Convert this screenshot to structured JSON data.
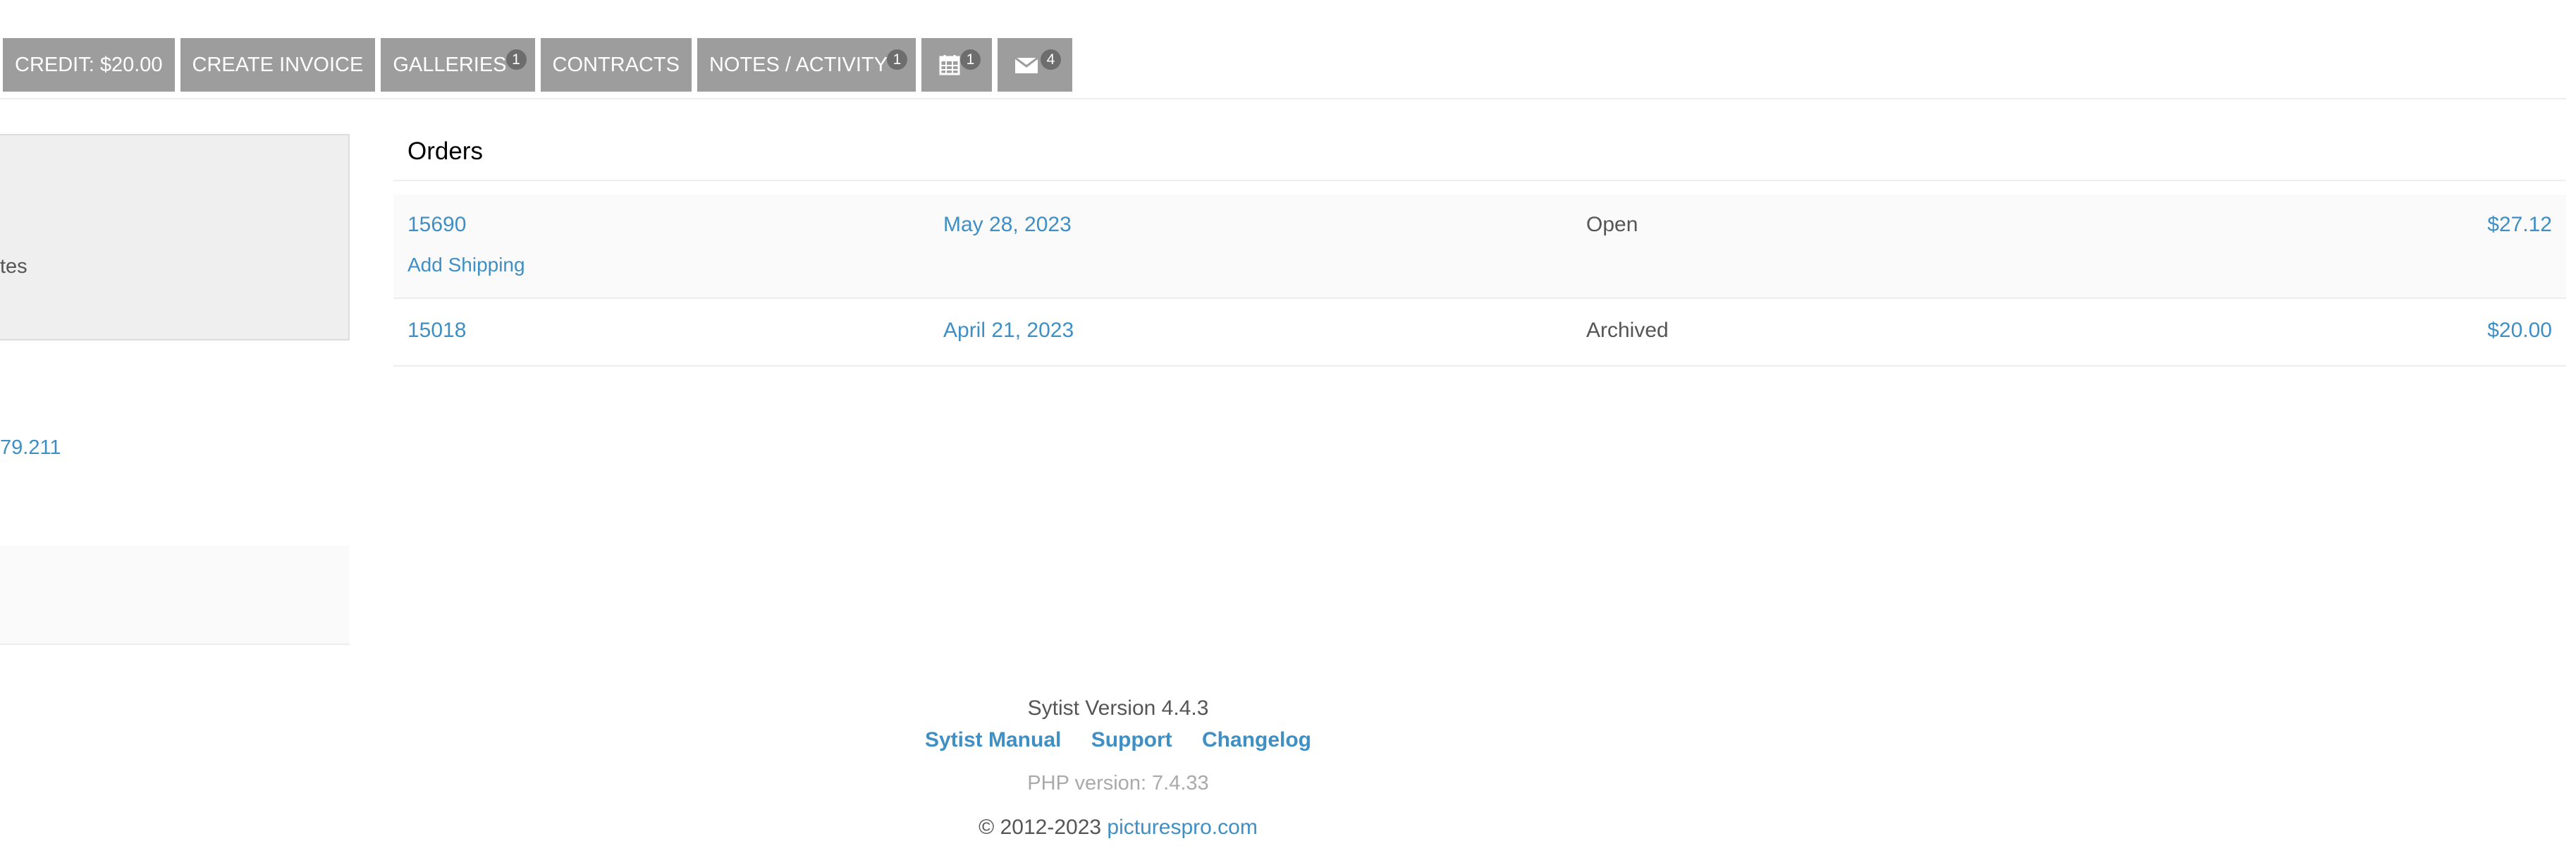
{
  "toolbar": {
    "credit_label": "CREDIT: $20.00",
    "create_invoice_label": "CREATE INVOICE",
    "galleries_label": "GALLERIES",
    "galleries_count": "1",
    "contracts_label": "CONTRACTS",
    "notes_label": "NOTES / ACTIVITY",
    "notes_count": "1",
    "calendar_icon": "calendar-icon",
    "calendar_count": "1",
    "mail_icon": "mail-icon",
    "mail_count": "4"
  },
  "sidebar": {
    "box_text": "tes",
    "link_text": "79.211"
  },
  "orders": {
    "title": "Orders",
    "rows": [
      {
        "id": "15690",
        "date": "May 28, 2023",
        "status": "Open",
        "total": "$27.12",
        "action": "Add Shipping"
      },
      {
        "id": "15018",
        "date": "April 21, 2023",
        "status": "Archived",
        "total": "$20.00"
      }
    ]
  },
  "footer": {
    "version": "Sytist Version 4.4.3",
    "links": [
      "Sytist Manual",
      "Support",
      "Changelog"
    ],
    "php_version": "PHP version: 7.4.33",
    "copyright": "© 2012-2023",
    "site": "picturespro.com"
  },
  "colors": {
    "button_bg": "#9d9d9d",
    "badge_bg": "#6d6d6d",
    "link": "#3f8fc4"
  }
}
